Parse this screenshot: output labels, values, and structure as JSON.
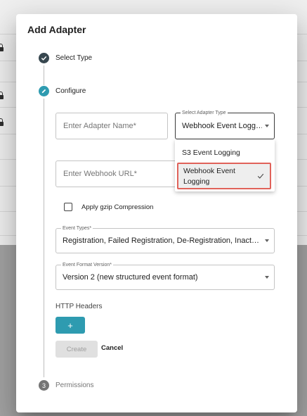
{
  "dialog": {
    "title": "Add Adapter"
  },
  "steps": [
    {
      "label": "Select Type",
      "state": "completed",
      "icon": "check-icon"
    },
    {
      "label": "Configure",
      "state": "active",
      "icon": "pencil-icon"
    },
    {
      "label": "Permissions",
      "state": "pending",
      "number": "3"
    }
  ],
  "form": {
    "adapter_name": {
      "placeholder": "Enter Adapter Name*",
      "value": ""
    },
    "adapter_type": {
      "label": "Select Adapter Type",
      "value": "Webhook Event Logg…",
      "options": [
        {
          "label": "S3 Event Logging",
          "selected": false
        },
        {
          "label": "Webhook Event Logging",
          "selected": true
        }
      ]
    },
    "webhook_url": {
      "placeholder": "Enter Webhook URL*",
      "value": ""
    },
    "gzip": {
      "label": "Apply gzip Compression",
      "checked": false
    },
    "event_types": {
      "label": "Event Types*",
      "value": "Registration, Failed Registration, De-Registration, Inact…"
    },
    "event_format_version": {
      "label": "Event Format Version*",
      "value": "Version 2 (new structured event format)"
    },
    "http_headers": {
      "label": "HTTP Headers",
      "add_label": "+"
    }
  },
  "actions": {
    "create_label": "Create",
    "cancel_label": "Cancel"
  },
  "colors": {
    "step_completed": "#37474f",
    "step_active": "#2e9bb0",
    "step_pending": "#757575",
    "accent_button": "#2e9bb0",
    "highlight_border": "#e0625a"
  }
}
